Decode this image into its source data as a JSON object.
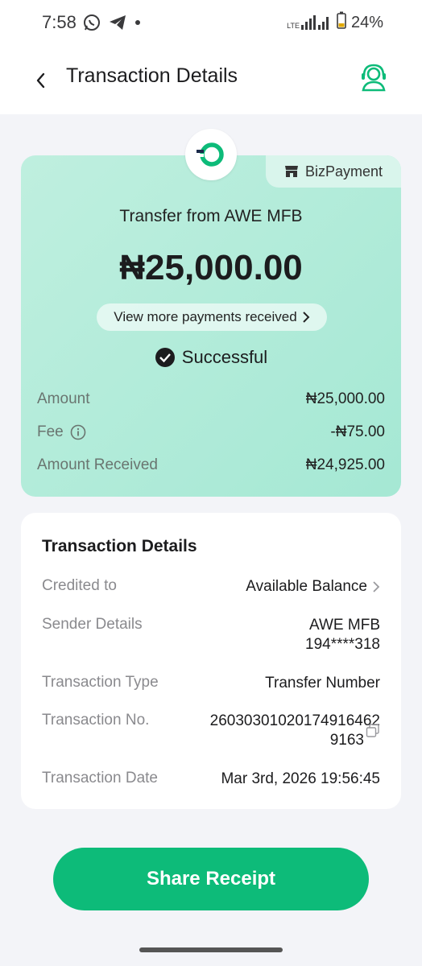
{
  "status_bar": {
    "time": "7:58",
    "battery": "24%",
    "network": "LTE"
  },
  "header": {
    "title": "Transaction Details"
  },
  "summary": {
    "badge_label": "BizPayment",
    "title": "Transfer from AWE MFB",
    "amount": "₦25,000.00",
    "view_more_label": "View more payments received",
    "status": "Successful",
    "rows": [
      {
        "label": "Amount",
        "value": "₦25,000.00"
      },
      {
        "label": "Fee",
        "value": "-₦75.00"
      },
      {
        "label": "Amount Received",
        "value": "₦24,925.00"
      }
    ]
  },
  "details": {
    "title": "Transaction Details",
    "credited_to": {
      "label": "Credited to",
      "value": "Available Balance"
    },
    "sender": {
      "label": "Sender Details",
      "name": "AWE MFB",
      "account": "194****318"
    },
    "type": {
      "label": "Transaction Type",
      "value": "Transfer Number"
    },
    "number": {
      "label": "Transaction No.",
      "line1": "26030301020174916462",
      "line2": "9163"
    },
    "date": {
      "label": "Transaction Date",
      "value": "Mar 3rd, 2026 19:56:45"
    }
  },
  "share_button_label": "Share Receipt",
  "colors": {
    "accent": "#0dbb79",
    "card_bg": "#b3ecd9",
    "page_bg": "#f3f4f8"
  },
  "icons": [
    "whatsapp-icon",
    "telegram-icon",
    "signal-icon",
    "battery-icon",
    "back-icon",
    "support-agent-icon",
    "store-icon",
    "brand-logo-icon",
    "chevron-right-icon",
    "check-circle-icon",
    "info-icon",
    "copy-icon"
  ]
}
